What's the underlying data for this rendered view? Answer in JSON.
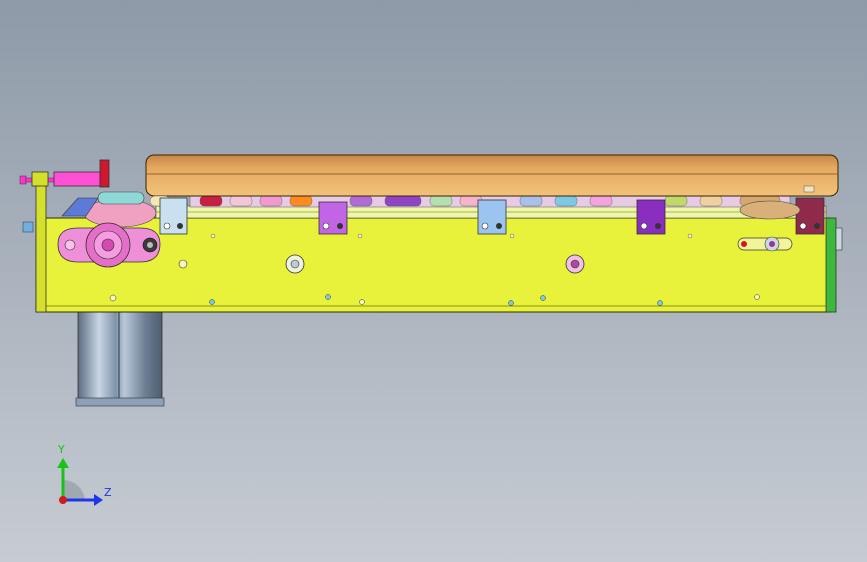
{
  "viewport": {
    "background_top": "#8e9aa8",
    "background_bottom": "#c7ccd3"
  },
  "model": {
    "frame_color": "#e8f23a",
    "tabletop_color": "#e6a85c",
    "motor_color": "#9fb3c8",
    "flange_color": "#e78bd6",
    "cylinder_rod_color": "#ff33cc",
    "cylinder_knob_color": "#d0182c",
    "bracket_colors": [
      "#c8e0f0",
      "#c264e6",
      "#9cc4f0",
      "#8a2ec0",
      "#8f2a4a"
    ]
  },
  "triad": {
    "y_label": "Y",
    "z_label": "Z",
    "y_color": "#16c316",
    "z_color": "#1b37e6",
    "x_color": "#d11a1a"
  }
}
